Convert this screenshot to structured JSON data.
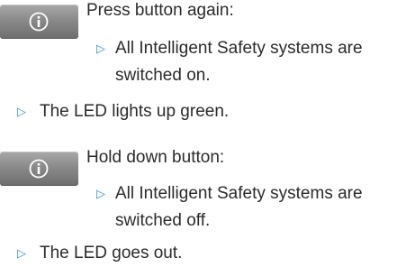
{
  "section1": {
    "intro": "Press button again:",
    "result_line1": "All Intelligent Safety systems are",
    "result_line2": "switched on.",
    "led": "The LED lights up green."
  },
  "section2": {
    "intro": "Hold down button:",
    "result_line1": "All Intelligent Safety systems are",
    "result_line2": "switched off.",
    "led": "The LED goes out."
  },
  "bullet": "▷",
  "colors": {
    "bullet": "#2f8fd3",
    "text": "#2b2b2b",
    "button": "#8a8a8a"
  },
  "icons": {
    "button": "intelligent-safety-button-icon"
  }
}
